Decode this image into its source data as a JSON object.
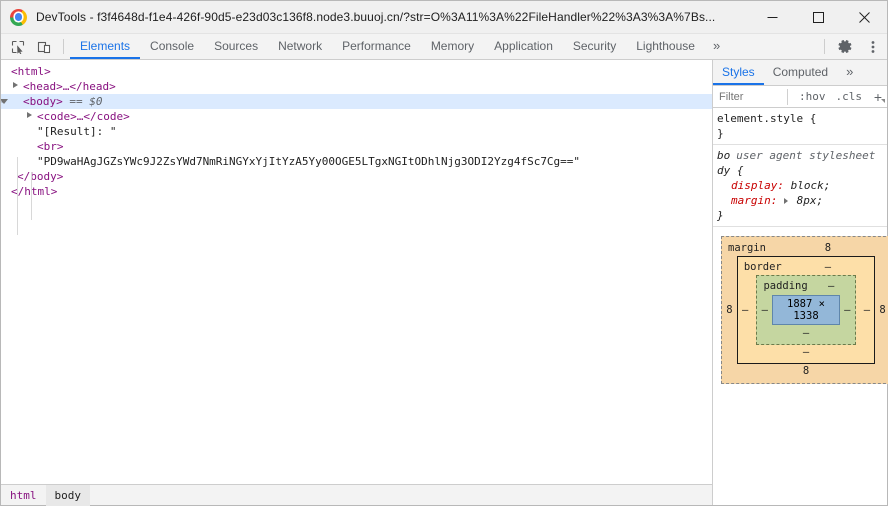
{
  "window": {
    "title": "DevTools - f3f4648d-f1e4-426f-90d5-e23d03c136f8.node3.buuoj.cn/?str=O%3A11%3A%22FileHandler%22%3A3%3A%7Bs...",
    "app_icon": "chrome-logo-icon",
    "controls": {
      "minimize": "minimize-icon",
      "maximize": "maximize-icon",
      "close": "close-icon"
    }
  },
  "toolbar": {
    "inspect_icon": "inspect-element-icon",
    "device_icon": "device-toolbar-icon",
    "tabs": [
      {
        "label": "Elements",
        "active": true
      },
      {
        "label": "Console",
        "active": false
      },
      {
        "label": "Sources",
        "active": false
      },
      {
        "label": "Network",
        "active": false
      },
      {
        "label": "Performance",
        "active": false
      },
      {
        "label": "Memory",
        "active": false
      },
      {
        "label": "Application",
        "active": false
      },
      {
        "label": "Security",
        "active": false
      },
      {
        "label": "Lighthouse",
        "active": false
      }
    ],
    "more_tabs": "»",
    "settings_icon": "gear-icon",
    "menu_icon": "kebab-menu-icon"
  },
  "dom_tree": {
    "nodes": [
      {
        "text": "<html>",
        "indent": 0,
        "twisty": "none",
        "selected": false
      },
      {
        "text": "<head>…</head>",
        "indent": 1,
        "twisty": "closed",
        "selected": false
      },
      {
        "text": "<body>",
        "suffix": "== $0",
        "indent": 1,
        "twisty": "open",
        "selected": true
      },
      {
        "text": "<code>…</code>",
        "indent": 2,
        "twisty": "closed",
        "selected": false
      },
      {
        "text": "\"[Result]: \"",
        "indent": 2,
        "twisty": "none",
        "selected": false
      },
      {
        "text": "<br>",
        "indent": 2,
        "twisty": "none",
        "selected": false
      },
      {
        "text": "\"PD9waHAgJGZsYWc9J2ZsYWd7NmRiNGYxYjItYzA5Yy00OGE5LTgxNGItODhlNjg3ODI2Yzg4fSc7Cg==\"",
        "indent": 2,
        "twisty": "none",
        "selected": false
      },
      {
        "text": "</body>",
        "indent": 1,
        "twisty": "none",
        "selected": false
      },
      {
        "text": "</html>",
        "indent": 0,
        "twisty": "none",
        "selected": false
      }
    ]
  },
  "breadcrumb": {
    "items": [
      {
        "label": "html",
        "active": false
      },
      {
        "label": "body",
        "active": true
      }
    ]
  },
  "styles_panel": {
    "tabs": [
      {
        "label": "Styles",
        "active": true
      },
      {
        "label": "Computed",
        "active": false
      }
    ],
    "more_tabs": "»",
    "filter_placeholder": "Filter",
    "filter_value": "",
    "hov_button": ":hov",
    "cls_button": ".cls",
    "new_rule_button": "+",
    "rules": [
      {
        "selector": "element.style {",
        "close": "}",
        "origin": "",
        "declarations": []
      },
      {
        "selector": "bo",
        "selector_wrap": "dy {",
        "origin": "user agent stylesheet",
        "close": "}",
        "declarations": [
          {
            "property": "display:",
            "value": "block;",
            "expandable": false
          },
          {
            "property": "margin:",
            "value": "8px;",
            "expandable": true
          }
        ]
      }
    ],
    "box_model": {
      "margin_label": "margin",
      "margin_top": "8",
      "margin_right": "8",
      "margin_bottom": "8",
      "margin_left": "8",
      "border_label": "border",
      "border_top": "–",
      "border_right": "–",
      "border_bottom": "–",
      "border_left": "–",
      "padding_label": "padding",
      "padding_top": "–",
      "padding_right": "–",
      "padding_bottom": "–",
      "padding_left": "–",
      "content_size": "1887 × 1338"
    }
  },
  "colors": {
    "accent": "#1a73e8",
    "selected_row": "#dbeafe",
    "tag": "#881280",
    "property": "#c80000",
    "margin_box": "#f6d6a7",
    "border_box": "#fddfa8",
    "padding_box": "#c5d6a0",
    "content_box": "#93b7d8"
  }
}
